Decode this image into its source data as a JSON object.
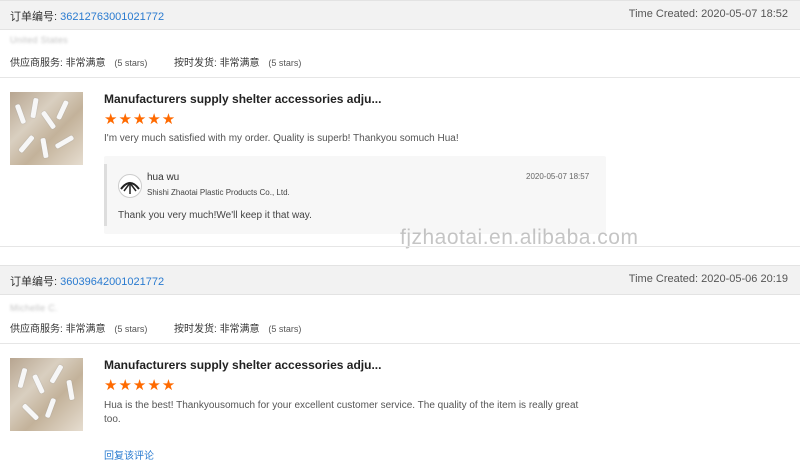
{
  "labels": {
    "order_no": "订单编号:",
    "time_created": "Time Created:",
    "supplier_service": "供应商服务:",
    "ship_on_time": "按时发货:"
  },
  "orders": [
    {
      "number": "36212763001021772",
      "time": "2020-05-07 18:52",
      "buyer": "United States",
      "supplier_rating": "非常满意",
      "supplier_stars": "(5 stars)",
      "shipping_rating": "非常满意",
      "shipping_stars": "(5 stars)",
      "product_title": "Manufacturers supply shelter accessories adju...",
      "stars": "★★★★★",
      "feedback": "I'm very much satisfied with my order. Quality is superb! Thankyou somuch Hua!",
      "reply": {
        "name": "hua wu",
        "company": "Shishi Zhaotai Plastic Products Co., Ltd.",
        "time": "2020-05-07 18:57",
        "text": "Thank you very much!We'll keep it that way."
      }
    },
    {
      "number": "36039642001021772",
      "time": "2020-05-06 20:19",
      "buyer": "Michelle C.",
      "supplier_rating": "非常满意",
      "supplier_stars": "(5 stars)",
      "shipping_rating": "非常满意",
      "shipping_stars": "(5 stars)",
      "product_title": "Manufacturers supply shelter accessories adju...",
      "stars": "★★★★★",
      "feedback": "Hua is the best! Thankyousomuch for your excellent customer service. The quality of the item is really great too.",
      "reply_link": "回复该评论"
    }
  ],
  "watermark": "fjzhaotai.en.alibaba.com",
  "colors": {
    "link": "#2a7bd0",
    "star": "#ff6a00",
    "header_bg": "#f2f2f2"
  },
  "icons": {
    "thumb": "product-thumbnail",
    "avatar": "supplier-avatar-icon"
  }
}
